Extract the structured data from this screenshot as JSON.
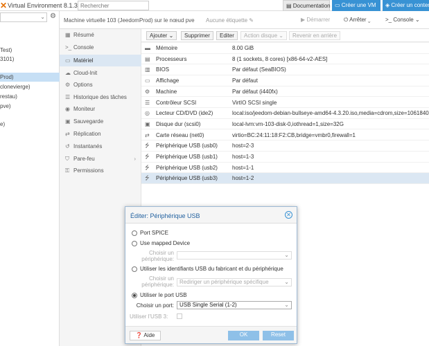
{
  "topbar": {
    "brand": "Virtual Environment 8.1.3",
    "search_placeholder": "Rechercher",
    "doc_label": "Documentation",
    "create_vm_label": "Créer une VM",
    "create_ct_label": "Créer un conten"
  },
  "tree": {
    "items": [
      "Test)",
      "3101)",
      "Prod)",
      "clonevierge)",
      "restau)",
      "pve)",
      "e)"
    ]
  },
  "header": {
    "vm_title": "Machine virtuelle 103 (JeedomProd) sur le nœud pve",
    "tags": "Aucune étiquette",
    "start_label": "Démarrer",
    "stop_label": "Arrêter",
    "console_label": "Console"
  },
  "nav": {
    "items": [
      {
        "label": "Résumé",
        "icon": "summary-icon"
      },
      {
        "label": "Console",
        "icon": "terminal-icon"
      },
      {
        "label": "Matériel",
        "icon": "monitor-icon"
      },
      {
        "label": "Cloud-Init",
        "icon": "cloud-icon"
      },
      {
        "label": "Options",
        "icon": "gear-icon"
      },
      {
        "label": "Historique des tâches",
        "icon": "list-icon"
      },
      {
        "label": "Moniteur",
        "icon": "eye-icon"
      },
      {
        "label": "Sauvegarde",
        "icon": "floppy-icon"
      },
      {
        "label": "Réplication",
        "icon": "retweet-icon"
      },
      {
        "label": "Instantanés",
        "icon": "history-icon"
      },
      {
        "label": "Pare-feu",
        "icon": "shield-icon"
      },
      {
        "label": "Permissions",
        "icon": "unlock-icon"
      }
    ]
  },
  "toolbar": {
    "add": "Ajouter",
    "remove": "Supprimer",
    "edit": "Editer",
    "disk_action": "Action disque",
    "revert": "Revenir en arrière"
  },
  "hardware": [
    {
      "icon": "memory-icon",
      "label": "Mémoire",
      "value": "8.00 GiB"
    },
    {
      "icon": "cpu-icon",
      "label": "Processeurs",
      "value": "8 (1 sockets, 8 cores) [x86-64-v2-AES]"
    },
    {
      "icon": "bios-icon",
      "label": "BIOS",
      "value": "Par défaut (SeaBIOS)"
    },
    {
      "icon": "display-icon",
      "label": "Affichage",
      "value": "Par défaut"
    },
    {
      "icon": "machine-icon",
      "label": "Machine",
      "value": "Par défaut (i440fx)"
    },
    {
      "icon": "database-icon",
      "label": "Contrôleur SCSI",
      "value": "VirtIO SCSI single"
    },
    {
      "icon": "cdrom-icon",
      "label": "Lecteur CD/DVD (ide2)",
      "value": "local:iso/jeedom-debian-bullseye-amd64-4.3.20.iso,media=cdrom,size=1061840"
    },
    {
      "icon": "hdd-icon",
      "label": "Disque dur (scsi0)",
      "value": "local-lvm:vm-103-disk-0,iothread=1,size=32G"
    },
    {
      "icon": "network-icon",
      "label": "Carte réseau (net0)",
      "value": "virtio=BC:24:11:18:F2:CB,bridge=vmbr0,firewall=1"
    },
    {
      "icon": "usb-icon",
      "label": "Périphérique USB (usb0)",
      "value": "host=2-3"
    },
    {
      "icon": "usb-icon",
      "label": "Périphérique USB (usb1)",
      "value": "host=1-3"
    },
    {
      "icon": "usb-icon",
      "label": "Périphérique USB (usb2)",
      "value": "host=1-1"
    },
    {
      "icon": "usb-icon",
      "label": "Périphérique USB (usb3)",
      "value": "host=1-2"
    }
  ],
  "modal": {
    "title": "Éditer: Périphérique USB",
    "option_spice": "Port SPICE",
    "option_mapped": "Use mapped Device",
    "choose_device_label": "Choisir un périphérique:",
    "option_vendor": "Utiliser les identifiants USB du fabricant et du périphérique",
    "choose_device_label2": "Choisir un périphérique:",
    "vendor_placeholder": "Rediriger un périphérique spécifique",
    "option_port": "Utiliser le port USB",
    "choose_port_label": "Choisir un port:",
    "port_value": "USB Single Serial (1-2)",
    "usb3_label": "Utiliser l'USB 3:",
    "help_label": "Aide",
    "ok_label": "OK",
    "reset_label": "Reset"
  },
  "colors": {
    "accent": "#3892d4",
    "selection": "#dbe7f3",
    "brand_orange": "#e57000"
  }
}
